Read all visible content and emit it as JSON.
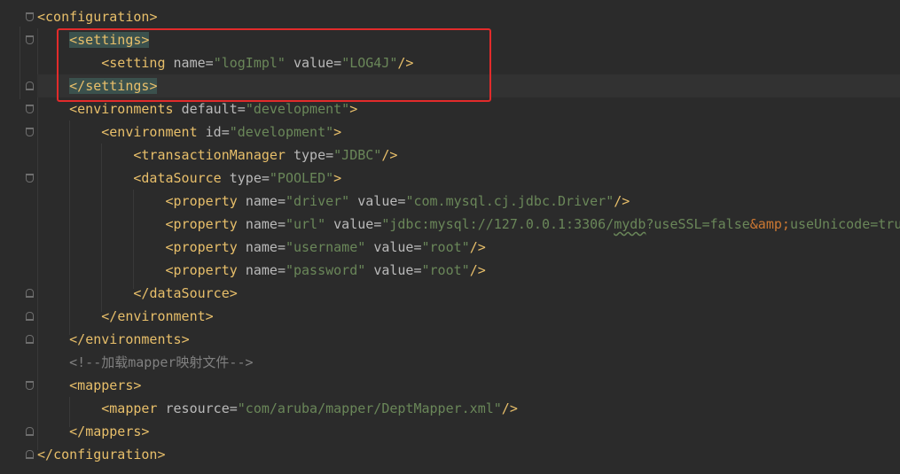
{
  "editor": {
    "language": "xml",
    "lines": [
      {
        "id": "l1",
        "text": "<configuration>"
      },
      {
        "id": "l2",
        "text": "<settings>"
      },
      {
        "id": "l3",
        "text": "<setting name=\"logImpl\" value=\"LOG4J\"/>"
      },
      {
        "id": "l4",
        "text": "</settings>"
      },
      {
        "id": "l5",
        "text": "<environments default=\"development\">"
      },
      {
        "id": "l6",
        "text": "<environment id=\"development\">"
      },
      {
        "id": "l7",
        "text": "<transactionManager type=\"JDBC\"/>"
      },
      {
        "id": "l8",
        "text": "<dataSource type=\"POOLED\">"
      },
      {
        "id": "l9",
        "text": "<property name=\"driver\" value=\"com.mysql.cj.jdbc.Driver\"/>"
      },
      {
        "id": "l10",
        "text": "<property name=\"url\" value=\"jdbc:mysql://127.0.0.1:3306/mydb?useSSL=false&amp;useUnicode=tru"
      },
      {
        "id": "l11",
        "text": "<property name=\"username\" value=\"root\"/>"
      },
      {
        "id": "l12",
        "text": "<property name=\"password\" value=\"root\"/>"
      },
      {
        "id": "l13",
        "text": "</dataSource>"
      },
      {
        "id": "l14",
        "text": "</environment>"
      },
      {
        "id": "l15",
        "text": "</environments>"
      },
      {
        "id": "l16",
        "text": "<!--加载mapper映射文件-->"
      },
      {
        "id": "l17",
        "text": "<mappers>"
      },
      {
        "id": "l18",
        "text": "<mapper resource=\"com/aruba/mapper/DeptMapper.xml\"/>"
      },
      {
        "id": "l19",
        "text": "</mappers>"
      },
      {
        "id": "l20",
        "text": "</configuration>"
      }
    ],
    "tokens": {
      "configuration": "configuration",
      "settings": "settings",
      "setting": "setting",
      "name_attr": "name",
      "value_attr": "value",
      "logImpl": "\"logImpl\"",
      "log4j": "\"LOG4J\"",
      "environments": "environments",
      "default_attr": "default",
      "development": "\"development\"",
      "environment": "environment",
      "id_attr": "id",
      "transactionManager": "transactionManager",
      "type_attr": "type",
      "jdbc": "\"JDBC\"",
      "dataSource": "dataSource",
      "pooled": "\"POOLED\"",
      "property": "property",
      "driver": "\"driver\"",
      "driver_class": "\"com.mysql.cj.jdbc.Driver\"",
      "url": "\"url\"",
      "url_value_a": "\"jdbc:mysql://127.0.0.1:3306/",
      "url_value_db": "mydb",
      "url_value_b": "?useSSL=false",
      "url_entity": "&amp;",
      "url_value_c": "useUnicode=tru",
      "username": "\"username\"",
      "password": "\"password\"",
      "root": "\"root\"",
      "comment": "<!--加载mapper映射文件-->",
      "mappers": "mappers",
      "mapper": "mapper",
      "resource_attr": "resource",
      "mapper_path": "\"com/aruba/mapper/DeptMapper.xml\""
    },
    "colors": {
      "background": "#2b2b2b",
      "tag": "#e8bf6a",
      "attribute": "#bababa",
      "string": "#6a8759",
      "entity": "#cc7832",
      "comment": "#808080",
      "matched_tag_highlight": "#3b514d",
      "annotation_box": "#e22b2b"
    }
  }
}
